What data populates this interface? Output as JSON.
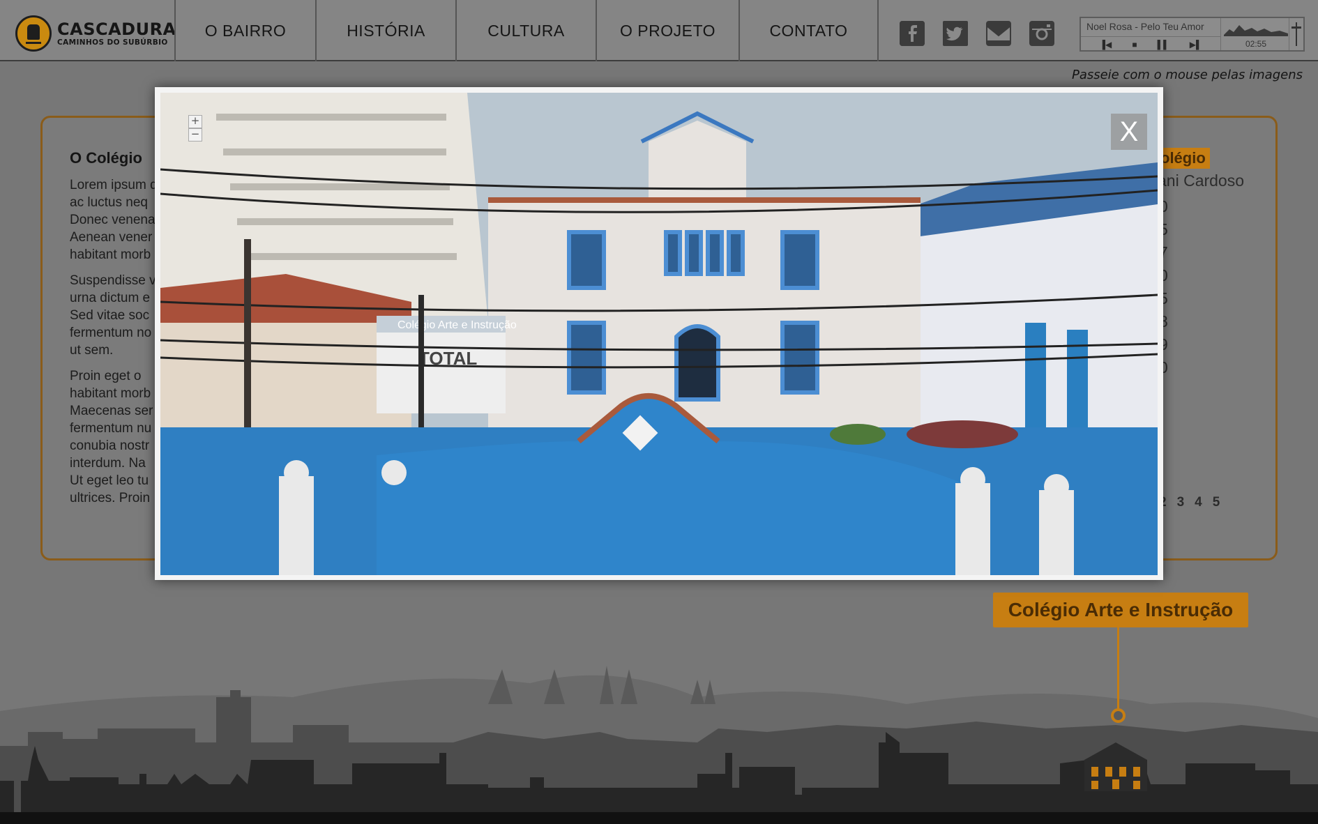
{
  "brand": {
    "title": "CASCADURA",
    "subtitle": "CAMINHOS DO SUBÚRBIO"
  },
  "nav": [
    {
      "label": "O BAIRRO"
    },
    {
      "label": "HISTÓRIA"
    },
    {
      "label": "CULTURA"
    },
    {
      "label": "O PROJETO"
    },
    {
      "label": "CONTATO"
    }
  ],
  "social": [
    {
      "icon": "facebook-icon"
    },
    {
      "icon": "twitter-icon"
    },
    {
      "icon": "mail-icon"
    },
    {
      "icon": "instagram-icon"
    }
  ],
  "player": {
    "track": "Noel Rosa - Pelo Teu Amor",
    "time": "02:55",
    "controls": [
      "previous-icon",
      "stop-icon",
      "pause-icon",
      "next-icon"
    ]
  },
  "hint": "Passeie com o mouse pelas imagens",
  "article": {
    "title": "O Colégio",
    "paragraphs": [
      [
        "Lorem ipsum d",
        "ac luctus neq",
        "Donec venena",
        "Aenean vener",
        "habitant morb"
      ],
      [
        "Suspendisse v",
        "urna dictum e",
        "Sed vitae soc",
        "fermentum no",
        "ut sem."
      ],
      [
        "Proin eget o",
        "habitant morb",
        "Maecenas ser",
        "fermentum nu",
        "conubia nostr",
        "interdum. Na",
        "Ut eget leo tu",
        "ultrices. Proin"
      ]
    ]
  },
  "info": {
    "label": "olégio",
    "name": "ani Cardoso",
    "list": [
      "0",
      "5",
      "7",
      "0",
      "5",
      "8",
      "9",
      "0"
    ]
  },
  "pager": [
    "2",
    "3",
    "4",
    "5"
  ],
  "modal": {
    "close_label": "X",
    "zoom_in": "+",
    "zoom_out": "−",
    "photo_sign": "Colégio Arte e Instrução",
    "photo_banner": "TOTAL"
  },
  "pointer": {
    "label": "Colégio Arte e Instrução"
  },
  "colors": {
    "accent": "#c77e12",
    "header": "#858585",
    "background": "#777777",
    "panel_border": "#8a5c1a"
  }
}
